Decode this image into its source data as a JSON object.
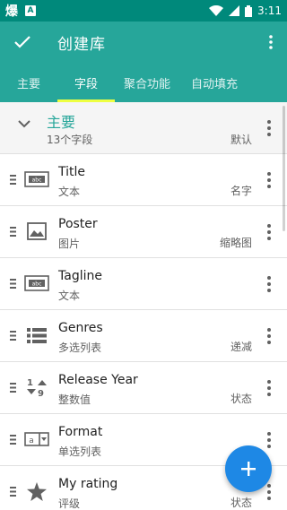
{
  "status_bar": {
    "app_glyph": "爆",
    "time": "3:11"
  },
  "app_bar": {
    "title": "创建库"
  },
  "tabs": [
    {
      "label": "主要",
      "active": false
    },
    {
      "label": "字段",
      "active": true
    },
    {
      "label": "聚合功能",
      "active": false
    },
    {
      "label": "自动填充",
      "active": false
    }
  ],
  "section": {
    "title": "主要",
    "subtitle": "13个字段",
    "right": "默认"
  },
  "fields": [
    {
      "title": "Title",
      "type": "文本",
      "extra": "名字",
      "icon": "text-field-icon"
    },
    {
      "title": "Poster",
      "type": "图片",
      "extra": "缩略图",
      "icon": "image-icon"
    },
    {
      "title": "Tagline",
      "type": "文本",
      "extra": "",
      "icon": "text-field-icon"
    },
    {
      "title": "Genres",
      "type": "多选列表",
      "extra": "递减",
      "icon": "list-icon"
    },
    {
      "title": "Release Year",
      "type": "整数值",
      "extra": "状态",
      "icon": "sort-numeric-icon"
    },
    {
      "title": "Format",
      "type": "单选列表",
      "extra": "",
      "icon": "dropdown-icon"
    },
    {
      "title": "My rating",
      "type": "评级",
      "extra": "状态",
      "icon": "star-icon"
    }
  ],
  "colors": {
    "primary": "#26a69a",
    "status_bar": "#00897b",
    "tab_indicator": "#eeff41",
    "fab": "#1e88e5"
  }
}
